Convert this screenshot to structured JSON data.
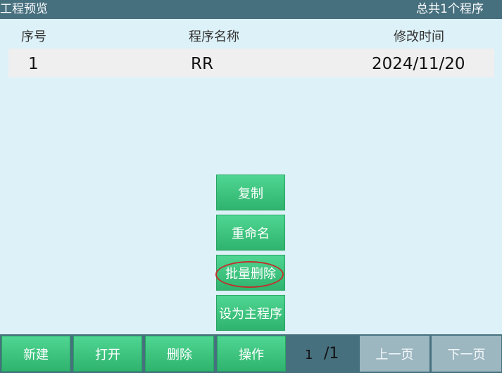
{
  "header": {
    "title": "工程预览",
    "total": "总共1个程序"
  },
  "table": {
    "columns": {
      "seq": "序号",
      "name": "程序名称",
      "time": "修改时间"
    },
    "rows": [
      {
        "seq": "1",
        "name": "RR",
        "time": "2024/11/20"
      }
    ]
  },
  "context_menu": {
    "copy": "复制",
    "rename": "重命名",
    "batch_delete": "批量删除",
    "set_main": "设为主程序"
  },
  "toolbar": {
    "new": "新建",
    "open": "打开",
    "delete": "删除",
    "operate": "操作",
    "page_current": "1",
    "page_total": "/1",
    "prev": "上一页",
    "next": "下一页"
  },
  "colors": {
    "background": "#ddf1f8",
    "bar": "#47707f",
    "button_green": "#3ec47e",
    "button_disabled": "#9db7c1",
    "row": "#efefef",
    "highlight": "#c0302b"
  }
}
